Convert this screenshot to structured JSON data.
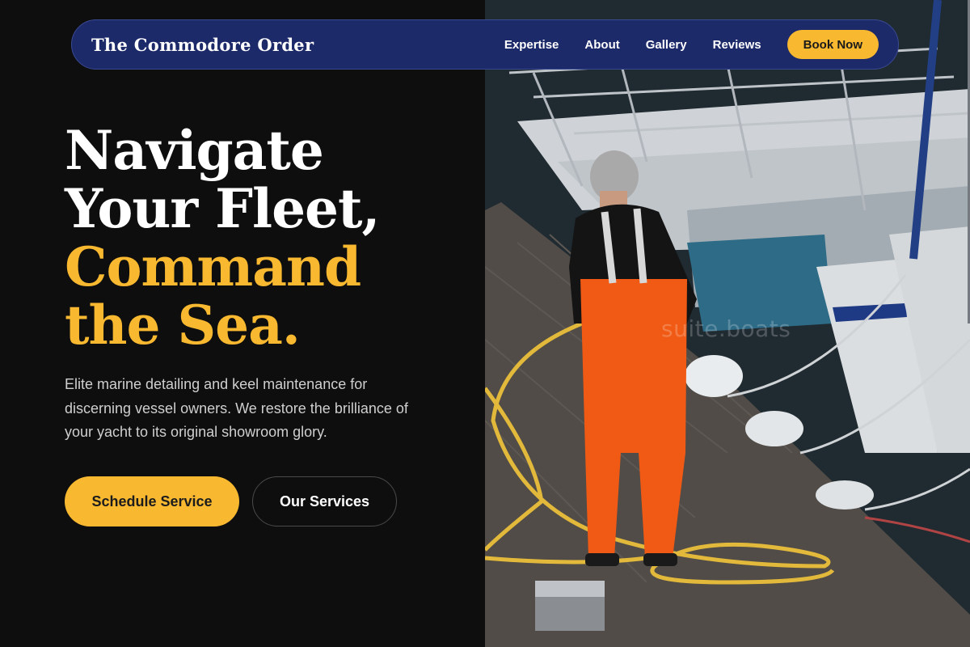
{
  "nav": {
    "brand": "The Commodore Order",
    "links": [
      "Expertise",
      "About",
      "Gallery",
      "Reviews"
    ],
    "cta": "Book Now"
  },
  "hero": {
    "title_line1": "Navigate",
    "title_line2": "Your Fleet,",
    "title_line3": "Command",
    "title_line4": "the Sea.",
    "description": "Elite marine detailing and keel maintenance for discerning vessel owners. We restore the brilliance of your yacht to its original showroom glory.",
    "primary_button": "Schedule Service",
    "secondary_button": "Our Services"
  },
  "photo": {
    "watermark": "suite.boats"
  },
  "colors": {
    "accent": "#f8b830",
    "nav_bg": "#1d2a6a",
    "page_bg": "#0e0e0f"
  }
}
